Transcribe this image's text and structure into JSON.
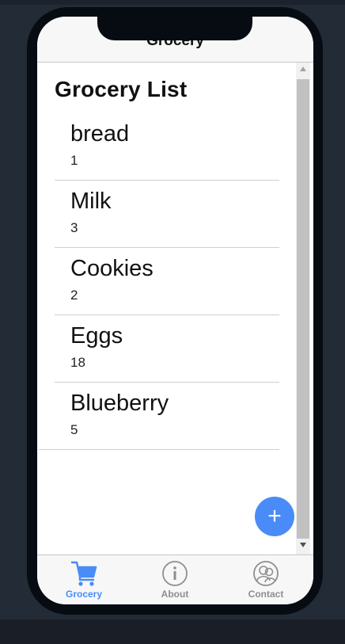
{
  "nav": {
    "title": "Grocery"
  },
  "page": {
    "title": "Grocery List"
  },
  "items": [
    {
      "name": "bread",
      "qty": "1"
    },
    {
      "name": "Milk",
      "qty": "3"
    },
    {
      "name": "Cookies",
      "qty": "2"
    },
    {
      "name": "Eggs",
      "qty": "18"
    },
    {
      "name": "Blueberry",
      "qty": "5"
    }
  ],
  "fab": {
    "label": "+"
  },
  "tabs": [
    {
      "label": "Grocery",
      "icon": "cart-icon",
      "active": true
    },
    {
      "label": "About",
      "icon": "info-icon",
      "active": false
    },
    {
      "label": "Contact",
      "icon": "contact-icon",
      "active": false
    }
  ],
  "colors": {
    "accent": "#4a8cf7",
    "inactive": "#8e8e8e"
  }
}
